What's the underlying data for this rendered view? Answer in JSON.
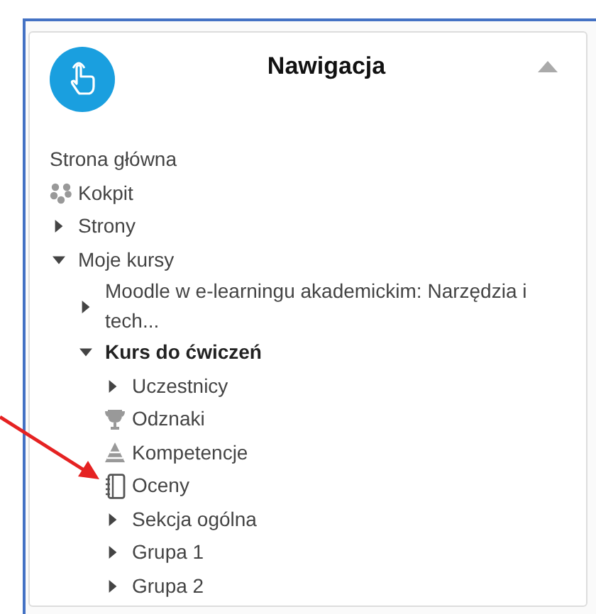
{
  "block": {
    "title": "Nawigacja",
    "collapsed": false
  },
  "tree": [
    {
      "label": "Strona główna",
      "kind": "plain"
    },
    {
      "label": "Kokpit",
      "kind": "dashboard"
    },
    {
      "label": "Strony",
      "kind": "branch",
      "expanded": false
    },
    {
      "label": "Moje kursy",
      "kind": "branch",
      "expanded": true,
      "children": [
        {
          "label": "Moodle w e-learningu akademickim: Narzędzia i tech...",
          "kind": "branch",
          "expanded": false
        },
        {
          "label": "Kurs do ćwiczeń",
          "kind": "branch",
          "expanded": true,
          "current": true,
          "children": [
            {
              "label": "Uczestnicy",
              "kind": "branch",
              "expanded": false
            },
            {
              "label": "Odznaki",
              "kind": "trophy"
            },
            {
              "label": "Kompetencje",
              "kind": "pyramid"
            },
            {
              "label": "Oceny",
              "kind": "notebook"
            },
            {
              "label": "Sekcja ogólna",
              "kind": "branch",
              "expanded": false
            },
            {
              "label": "Grupa 1",
              "kind": "branch",
              "expanded": false
            },
            {
              "label": "Grupa 2",
              "kind": "branch",
              "expanded": false
            }
          ]
        }
      ]
    }
  ]
}
